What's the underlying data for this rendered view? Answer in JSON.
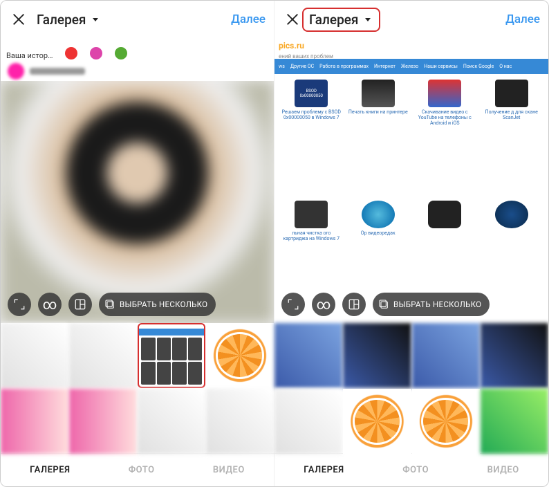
{
  "left": {
    "title": "Галерея",
    "next": "Далее",
    "your_story": "Ваша истор…",
    "select_multiple": "ВЫБРАТЬ НЕСКОЛЬКО",
    "tabs": {
      "gallery": "ГАЛЕРЕЯ",
      "photo": "ФОТО",
      "video": "ВИДЕО"
    }
  },
  "right": {
    "title": "Галерея",
    "next": "Далее",
    "site_brand": "pics.ru",
    "site_tagline": "ений ваших проблем",
    "nav": [
      "ws",
      "Другие ОС",
      "Работа в программах",
      "Интернет",
      "Железо",
      "Наши сервисы",
      "Поиск Google",
      "О нас"
    ],
    "cards": [
      {
        "title": "Решаем проблему с BSOD 0x00000050 в Windows 7",
        "ico_label": "BSOD 0x00000050"
      },
      {
        "title": "Печать книги на принтере",
        "ico_label": ""
      },
      {
        "title": "Скачивание видео с YouTube на телефоны с Android и iOS",
        "ico_label": ""
      },
      {
        "title": "Получение д для скане ScanJet",
        "ico_label": ""
      },
      {
        "title": "льная чистка ого картриджа на Windows 7",
        "ico_label": ""
      },
      {
        "title": "Ор видеоредак",
        "ico_label": ""
      },
      {
        "title": "",
        "ico_label": ""
      },
      {
        "title": "",
        "ico_label": ""
      }
    ],
    "select_multiple": "ВЫБРАТЬ НЕСКОЛЬКО",
    "tabs": {
      "gallery": "ГАЛЕРЕЯ",
      "photo": "ФОТО",
      "video": "ВИДЕО"
    }
  }
}
